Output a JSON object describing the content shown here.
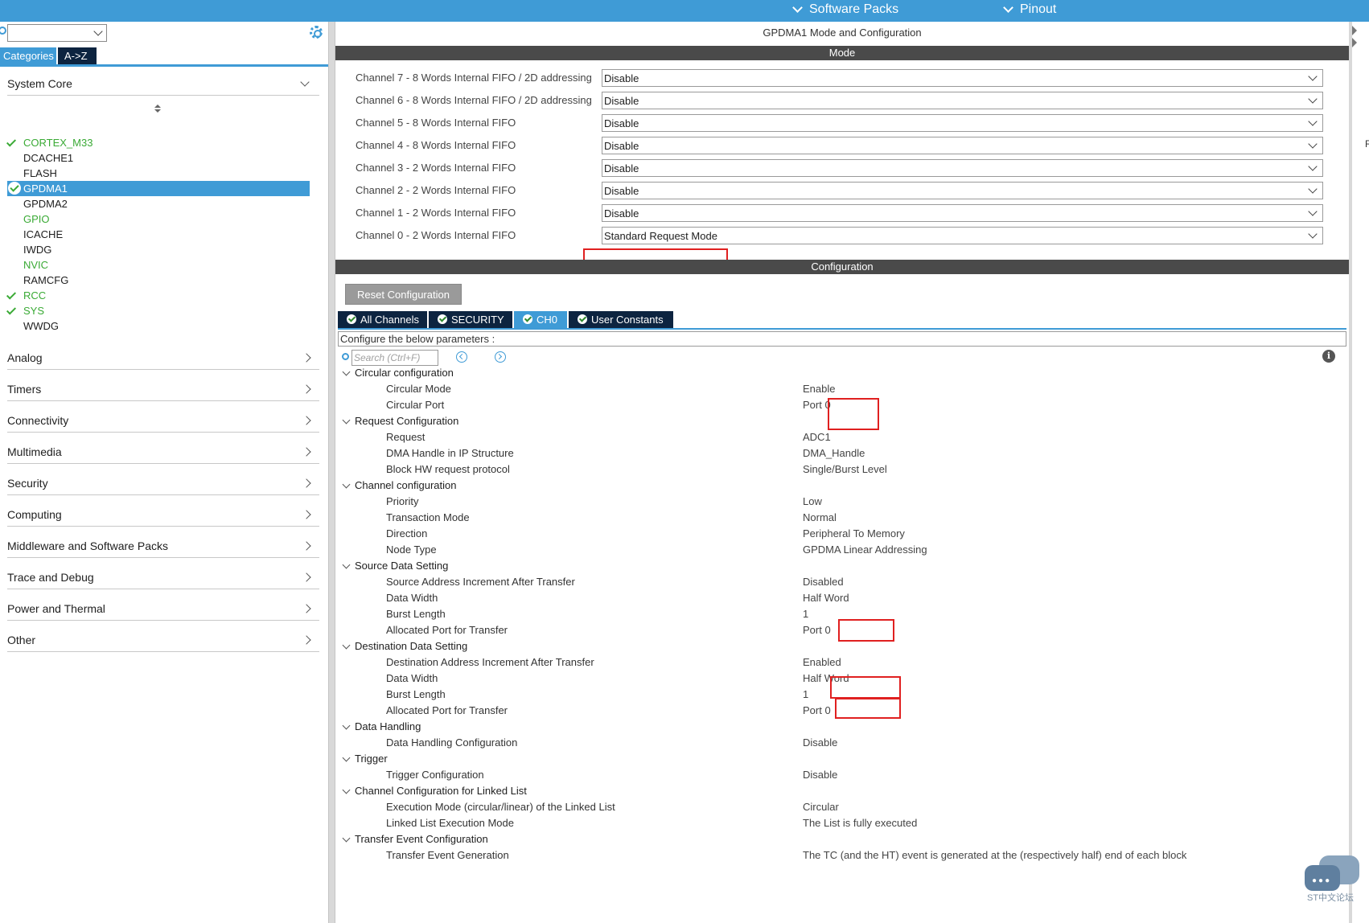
{
  "topbar": {
    "menus": [
      "Software Packs",
      "Pinout"
    ]
  },
  "sidebar": {
    "tabs": [
      "Categories",
      "A->Z"
    ],
    "groups_top": {
      "label": "System Core"
    },
    "peripherals": [
      {
        "name": "CORTEX_M33",
        "checked": true,
        "green": true,
        "selected": false
      },
      {
        "name": "DCACHE1",
        "checked": false,
        "green": false,
        "selected": false
      },
      {
        "name": "FLASH",
        "checked": false,
        "green": false,
        "selected": false
      },
      {
        "name": "GPDMA1",
        "checked": true,
        "green": false,
        "selected": true
      },
      {
        "name": "GPDMA2",
        "checked": false,
        "green": false,
        "selected": false
      },
      {
        "name": "GPIO",
        "checked": false,
        "green": true,
        "selected": false
      },
      {
        "name": "ICACHE",
        "checked": false,
        "green": false,
        "selected": false
      },
      {
        "name": "IWDG",
        "checked": false,
        "green": false,
        "selected": false
      },
      {
        "name": "NVIC",
        "checked": false,
        "green": true,
        "selected": false
      },
      {
        "name": "RAMCFG",
        "checked": false,
        "green": false,
        "selected": false
      },
      {
        "name": "RCC",
        "checked": true,
        "green": true,
        "selected": false
      },
      {
        "name": "SYS",
        "checked": true,
        "green": true,
        "selected": false
      },
      {
        "name": "WWDG",
        "checked": false,
        "green": false,
        "selected": false
      }
    ],
    "groups": [
      "Analog",
      "Timers",
      "Connectivity",
      "Multimedia",
      "Security",
      "Computing",
      "Middleware and Software Packs",
      "Trace and Debug",
      "Power and Thermal",
      "Other"
    ]
  },
  "main": {
    "title": "GPDMA1 Mode and Configuration",
    "mode_bar": "Mode",
    "mode_rows": [
      {
        "label": "Channel 7  - 8 Words Internal FIFO / 2D addressing",
        "value": "Disable"
      },
      {
        "label": "Channel 6  - 8 Words Internal FIFO / 2D addressing",
        "value": "Disable"
      },
      {
        "label": "Channel 5  - 8 Words Internal FIFO",
        "value": "Disable"
      },
      {
        "label": "Channel 4  - 8 Words Internal FIFO",
        "value": "Disable"
      },
      {
        "label": "Channel 3  - 2 Words Internal FIFO",
        "value": "Disable"
      },
      {
        "label": "Channel 2  - 2 Words Internal FIFO",
        "value": "Disable"
      },
      {
        "label": "Channel 1  - 2 Words Internal FIFO",
        "value": "Disable"
      },
      {
        "label": "Channel 0  - 2 Words Internal FIFO",
        "value": "Standard Request Mode"
      }
    ],
    "config_bar": "Configuration",
    "reset_label": "Reset Configuration",
    "config_tabs": [
      "All Channels",
      "SECURITY",
      "CH0",
      "User Constants"
    ],
    "active_tab": "CH0",
    "param_hint": "Configure the below parameters :",
    "search_placeholder": "Search (Ctrl+F)",
    "tree": [
      {
        "section": "Circular configuration",
        "params": [
          {
            "name": "Circular Mode",
            "value": "Enable"
          },
          {
            "name": "Circular Port",
            "value": "Port 0"
          }
        ]
      },
      {
        "section": "Request Configuration",
        "params": [
          {
            "name": "Request",
            "value": "ADC1"
          },
          {
            "name": "DMA Handle in IP Structure",
            "value": "DMA_Handle"
          },
          {
            "name": "Block HW request protocol",
            "value": "Single/Burst Level"
          }
        ]
      },
      {
        "section": "Channel configuration",
        "params": [
          {
            "name": "Priority",
            "value": "Low"
          },
          {
            "name": "Transaction Mode",
            "value": "Normal"
          },
          {
            "name": "Direction",
            "value": "Peripheral To Memory"
          },
          {
            "name": "Node Type",
            "value": "GPDMA Linear Addressing"
          }
        ]
      },
      {
        "section": "Source Data Setting",
        "params": [
          {
            "name": "Source Address Increment After Transfer",
            "value": "Disabled"
          },
          {
            "name": "Data Width",
            "value": "Half Word"
          },
          {
            "name": "Burst Length",
            "value": "1"
          },
          {
            "name": "Allocated Port for Transfer",
            "value": "Port 0"
          }
        ]
      },
      {
        "section": "Destination Data Setting",
        "params": [
          {
            "name": "Destination Address Increment After Transfer",
            "value": "Enabled"
          },
          {
            "name": "Data Width",
            "value": "Half Word"
          },
          {
            "name": "Burst Length",
            "value": "1"
          },
          {
            "name": "Allocated Port for Transfer",
            "value": "Port 0"
          }
        ]
      },
      {
        "section": "Data Handling",
        "params": [
          {
            "name": "Data Handling Configuration",
            "value": "Disable"
          }
        ]
      },
      {
        "section": "Trigger",
        "params": [
          {
            "name": "Trigger Configuration",
            "value": "Disable"
          }
        ]
      },
      {
        "section": "Channel Configuration for Linked List",
        "params": [
          {
            "name": "Execution Mode (circular/linear) of the Linked List",
            "value": "Circular"
          },
          {
            "name": "Linked List Execution Mode",
            "value": "The List is fully executed"
          }
        ]
      },
      {
        "section": "Transfer Event Configuration",
        "params": [
          {
            "name": "Transfer Event Generation",
            "value": "The TC (and the HT) event is generated at the (respectively half) end of each block"
          }
        ]
      }
    ]
  },
  "right_edge": {
    "letter": "R"
  },
  "watermark": {
    "label": "ST中文论坛"
  },
  "colors": {
    "accent": "#3f9bd6",
    "dark_tab": "#0d2440",
    "green": "#3aaa35",
    "highlight": "#e02020",
    "bar": "#4a4a4a"
  }
}
